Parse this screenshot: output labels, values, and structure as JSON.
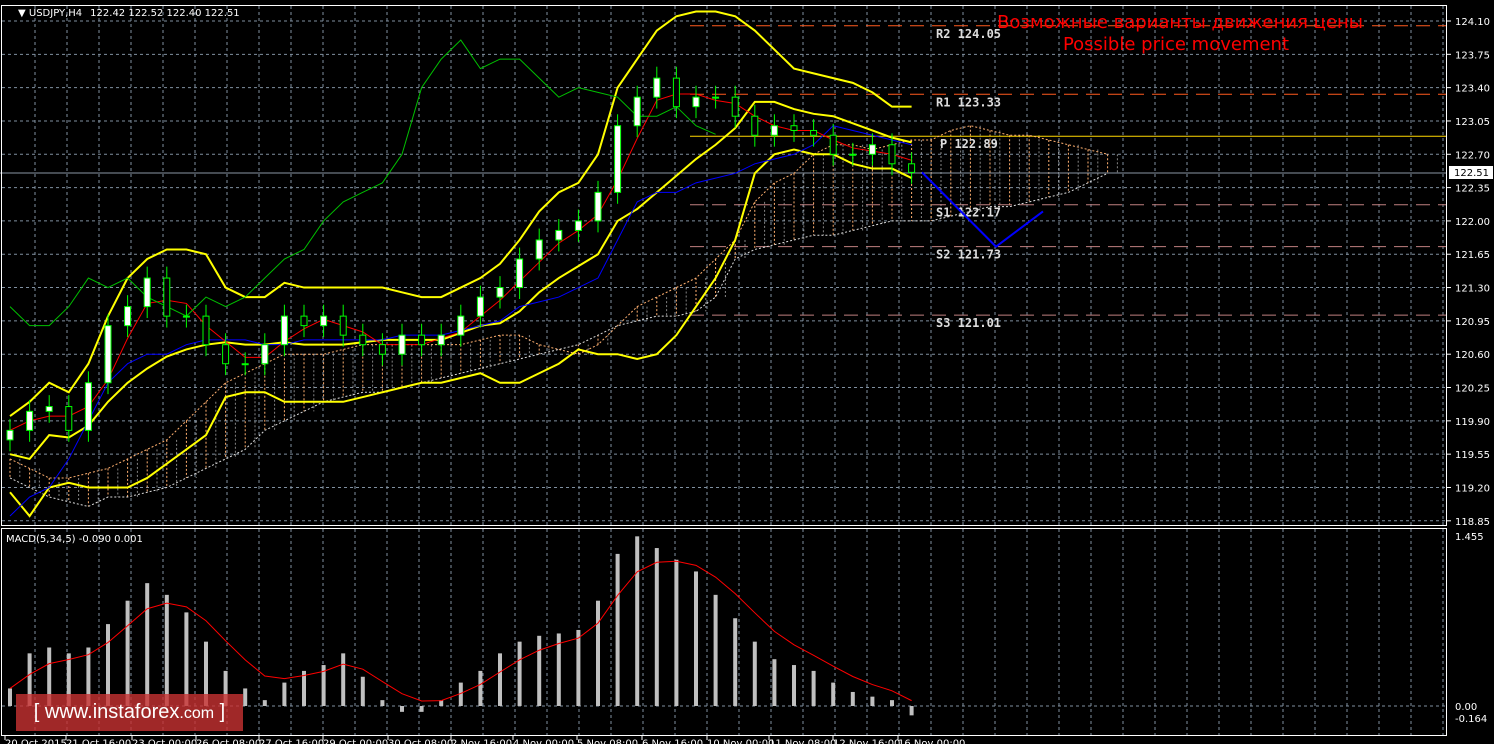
{
  "header": {
    "symbol": "USDJPY,H4",
    "ohlc": "122.42 122.52 122.40 122.51"
  },
  "annotation": {
    "line1": "Возможные варианты движения цены",
    "line2": "Possible price movement"
  },
  "watermark": {
    "open": "[",
    "domain": "www.instaforex",
    "tld": ".com",
    "close": "]"
  },
  "macd_label": "MACD(5,34,5) -0.090 0.001",
  "current_price": "122.51",
  "colors": {
    "bull": "#ffffff",
    "bear": "#000000",
    "candle_outline": "#00ff00",
    "bands": "#ffff00",
    "kijun": "#0000ff",
    "tenkan": "#ff0000",
    "chikou": "#00c000",
    "cloud": "#ffb070",
    "grid": "#8090a0",
    "macd_hist": "#c0c0c0",
    "macd_signal": "#ff0000"
  },
  "chart_data": {
    "type": "candlestick",
    "title": "USDJPY,H4",
    "ylim": [
      118.85,
      124.1
    ],
    "price_ticks": [
      "124.10",
      "123.75",
      "123.40",
      "123.05",
      "122.70",
      "122.35",
      "122.00",
      "121.65",
      "121.30",
      "120.95",
      "120.60",
      "120.25",
      "119.90",
      "119.55",
      "119.20",
      "118.85"
    ],
    "time_labels": [
      "20 Oct 2015",
      "21 Oct 16:00",
      "23 Oct 00:00",
      "26 Oct 08:00",
      "27 Oct 16:00",
      "29 Oct 00:00",
      "30 Oct 08:00",
      "2 Nov 16:00",
      "4 Nov 00:00",
      "5 Nov 08:00",
      "6 Nov 16:00",
      "10 Nov 00:00",
      "11 Nov 08:00",
      "12 Nov 16:00",
      "16 Nov 00:00"
    ],
    "closes": [
      119.8,
      120.0,
      120.05,
      119.8,
      120.3,
      120.9,
      121.1,
      121.4,
      121.0,
      121.0,
      120.7,
      120.5,
      120.5,
      120.7,
      121.0,
      120.9,
      121.0,
      120.8,
      120.7,
      120.6,
      120.8,
      120.7,
      120.8,
      121.0,
      121.2,
      121.3,
      121.6,
      121.8,
      121.9,
      122.0,
      122.3,
      123.0,
      123.3,
      123.5,
      123.2,
      123.3,
      123.3,
      123.1,
      122.9,
      123.0,
      122.95,
      122.9,
      122.7,
      122.7,
      122.8,
      122.6,
      122.51
    ],
    "bb_upper": [
      119.95,
      120.1,
      120.3,
      120.2,
      120.5,
      121.0,
      121.4,
      121.6,
      121.7,
      121.7,
      121.65,
      121.3,
      121.2,
      121.2,
      121.35,
      121.3,
      121.3,
      121.3,
      121.3,
      121.3,
      121.25,
      121.2,
      121.2,
      121.3,
      121.4,
      121.55,
      121.8,
      122.1,
      122.3,
      122.4,
      122.7,
      123.4,
      123.7,
      124.0,
      124.15,
      124.2,
      124.2,
      124.15,
      124.0,
      123.8,
      123.6,
      123.55,
      123.5,
      123.45,
      123.35,
      123.2,
      123.2
    ],
    "bb_lower": [
      119.15,
      118.9,
      119.2,
      119.25,
      119.2,
      119.2,
      119.2,
      119.3,
      119.45,
      119.6,
      119.75,
      120.15,
      120.2,
      120.2,
      120.1,
      120.1,
      120.1,
      120.1,
      120.15,
      120.2,
      120.25,
      120.3,
      120.3,
      120.35,
      120.4,
      120.3,
      120.3,
      120.4,
      120.5,
      120.65,
      120.6,
      120.6,
      120.55,
      120.6,
      120.8,
      121.1,
      121.4,
      121.8,
      122.5,
      122.7,
      122.75,
      122.7,
      122.7,
      122.6,
      122.55,
      122.55,
      122.45
    ],
    "kijun": [
      118.9,
      119.1,
      119.2,
      119.5,
      119.9,
      120.3,
      120.5,
      120.6,
      120.6,
      120.7,
      120.75,
      120.75,
      120.75,
      120.7,
      120.7,
      120.75,
      120.75,
      120.75,
      120.75,
      120.75,
      120.8,
      120.8,
      120.8,
      120.85,
      120.9,
      120.95,
      121.1,
      121.15,
      121.2,
      121.3,
      121.4,
      121.8,
      122.2,
      122.3,
      122.3,
      122.4,
      122.45,
      122.5,
      122.6,
      122.65,
      122.7,
      122.8,
      123.0,
      122.95,
      122.9,
      122.85,
      122.8
    ],
    "cloud_a": [
      119.5,
      119.4,
      119.3,
      119.3,
      119.35,
      119.4,
      119.5,
      119.6,
      119.7,
      119.9,
      120.1,
      120.3,
      120.4,
      120.5,
      120.6,
      120.6,
      120.6,
      120.65,
      120.7,
      120.7,
      120.7,
      120.7,
      120.7,
      120.7,
      120.75,
      120.8,
      120.8,
      120.7,
      120.65,
      120.6,
      120.7,
      120.9,
      121.1,
      121.2,
      121.3,
      121.4,
      121.6,
      121.8,
      122.2,
      122.4,
      122.5,
      122.7,
      122.8,
      122.8,
      122.75,
      122.8,
      122.85,
      122.85,
      122.95,
      123.0,
      122.95,
      122.9,
      122.9,
      122.85,
      122.8,
      122.75,
      122.7
    ],
    "cloud_b": [
      119.3,
      119.2,
      119.1,
      119.05,
      119.0,
      119.1,
      119.1,
      119.15,
      119.2,
      119.3,
      119.4,
      119.5,
      119.6,
      119.8,
      119.9,
      120.0,
      120.1,
      120.15,
      120.2,
      120.2,
      120.25,
      120.3,
      120.35,
      120.4,
      120.45,
      120.5,
      120.55,
      120.6,
      120.65,
      120.7,
      120.8,
      120.9,
      120.95,
      121.0,
      121.0,
      121.05,
      121.2,
      121.6,
      121.7,
      121.75,
      121.8,
      121.85,
      121.85,
      121.9,
      121.95,
      122.0,
      122.0,
      122.0,
      122.05,
      122.1,
      122.15,
      122.15,
      122.2,
      122.25,
      122.3,
      122.4,
      122.5
    ],
    "macd_ylim": [
      -0.164,
      1.455
    ],
    "macd_ticks": [
      "1.455",
      "0.00",
      "-0.164"
    ],
    "macd_hist": [
      0.15,
      0.45,
      0.5,
      0.45,
      0.5,
      0.7,
      0.9,
      1.05,
      0.95,
      0.8,
      0.55,
      0.3,
      0.15,
      0.05,
      0.2,
      0.3,
      0.35,
      0.45,
      0.25,
      0.05,
      -0.05,
      -0.05,
      0.05,
      0.2,
      0.3,
      0.45,
      0.55,
      0.6,
      0.62,
      0.65,
      0.9,
      1.3,
      1.45,
      1.35,
      1.25,
      1.15,
      0.95,
      0.75,
      0.55,
      0.4,
      0.35,
      0.3,
      0.2,
      0.12,
      0.08,
      0.05,
      -0.08
    ],
    "pivots": [
      {
        "label": "R2",
        "value": "124.05",
        "color": "#ff5a1e"
      },
      {
        "label": "R1",
        "value": "123.33",
        "color": "#ff5a1e"
      },
      {
        "label": "P",
        "value": "122.89",
        "color": "#ffd700"
      },
      {
        "label": "S1",
        "value": "122.17",
        "color": "#c08080"
      },
      {
        "label": "S2",
        "value": "121.73",
        "color": "#c08080"
      },
      {
        "label": "S3",
        "value": "121.01",
        "color": "#c08080"
      }
    ],
    "forecast_path": [
      122.51,
      121.73,
      122.1
    ]
  }
}
